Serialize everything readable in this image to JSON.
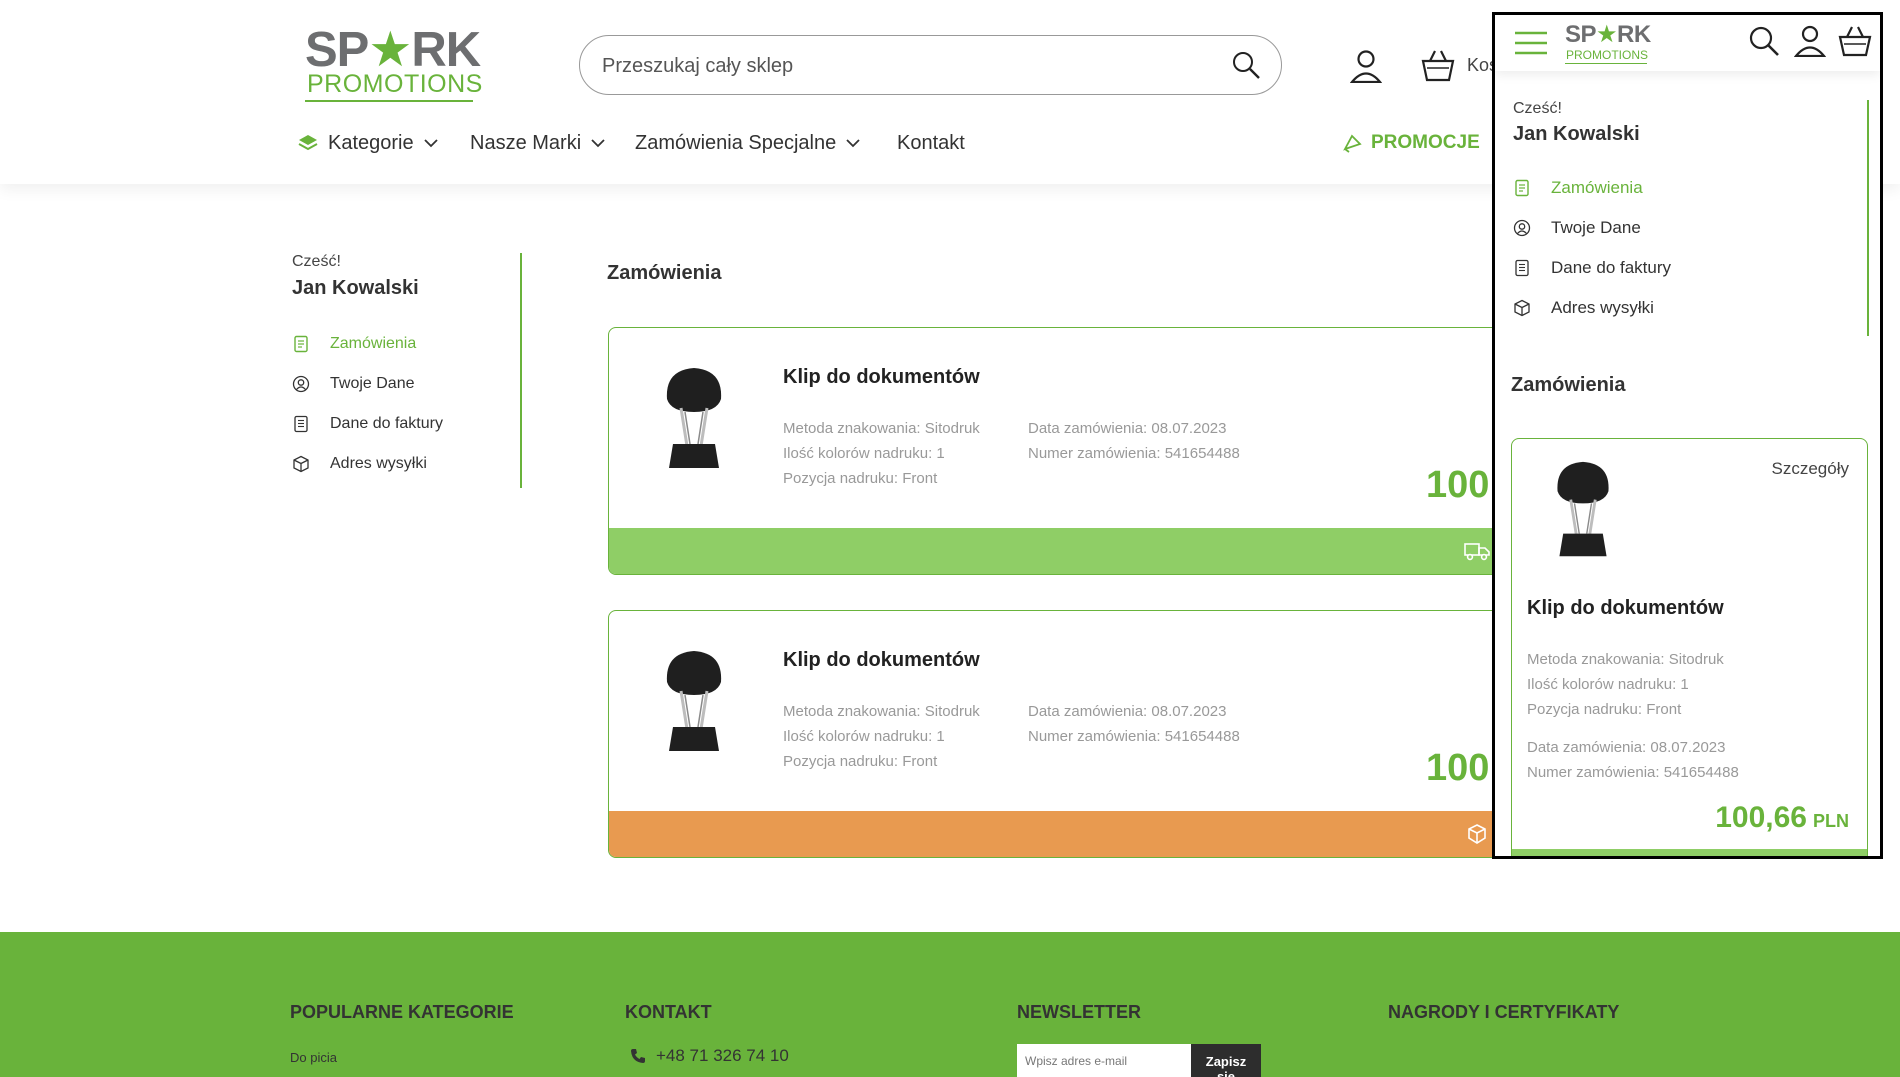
{
  "brand": {
    "line1_a": "SP",
    "line1_star": "★",
    "line1_b": "RK",
    "line2": "PROMOTIONS"
  },
  "header": {
    "search_placeholder": "Przeszukaj cały sklep",
    "cart_label": "Kos"
  },
  "nav": {
    "kategorie": "Kategorie",
    "marki": "Nasze Marki",
    "zamowienia_specjalne": "Zamówienia Specjalne",
    "kontakt": "Kontakt",
    "promocje": "PROMOCJE"
  },
  "account": {
    "greeting": "Cześć!",
    "name": "Jan Kowalski",
    "menu": [
      {
        "label": "Zamówienia",
        "icon": "orders-icon",
        "active": true
      },
      {
        "label": "Twoje Dane",
        "icon": "user-circle-icon",
        "active": false
      },
      {
        "label": "Dane do faktury",
        "icon": "invoice-icon",
        "active": false
      },
      {
        "label": "Adres wysyłki",
        "icon": "package-icon",
        "active": false
      }
    ]
  },
  "main": {
    "title": "Zamówienia",
    "orders": [
      {
        "product": "Klip do dokumentów",
        "method": "Metoda znakowania: Sitodruk",
        "colors": "Ilość kolorów nadruku: 1",
        "position": "Pozycja nadruku: Front",
        "date": "Data zamówienia: 08.07.2023",
        "number": "Numer zamówienia: 541654488",
        "price": "100,",
        "status_color": "#8fce66",
        "status_icon": "truck-icon"
      },
      {
        "product": "Klip do dokumentów",
        "method": "Metoda znakowania: Sitodruk",
        "colors": "Ilość kolorów nadruku: 1",
        "position": "Pozycja nadruku: Front",
        "date": "Data zamówienia: 08.07.2023",
        "number": "Numer zamówienia: 541654488",
        "price": "100,",
        "status_color": "#e89a50",
        "status_icon": "package-icon"
      }
    ]
  },
  "footer": {
    "popular": "POPULARNE KATEGORIE",
    "popular_item": "Do picia",
    "kontakt": "KONTAKT",
    "phone": "+48 71 326 74 10",
    "newsletter": "NEWSLETTER",
    "newsletter_placeholder": "Wpisz adres e-mail",
    "newsletter_button": "Zapisz się",
    "awards": "NAGRODY I CERTYFIKATY"
  },
  "mobile": {
    "greeting": "Cześć!",
    "name": "Jan Kowalski",
    "menu": [
      {
        "label": "Zamówienia",
        "active": true
      },
      {
        "label": "Twoje Dane",
        "active": false
      },
      {
        "label": "Dane do faktury",
        "active": false
      },
      {
        "label": "Adres wysyłki",
        "active": false
      }
    ],
    "title": "Zamówienia",
    "order": {
      "details": "Szczegóły",
      "product": "Klip do dokumentów",
      "method": "Metoda znakowania: Sitodruk",
      "colors": "Ilość kolorów nadruku: 1",
      "position": "Pozycja nadruku: Front",
      "date": "Data zamówienia: 08.07.2023",
      "number": "Numer zamówienia: 541654488",
      "price": "100,66",
      "currency": "PLN"
    }
  },
  "colors": {
    "brand_green": "#69b33b",
    "status_green": "#8fce66",
    "status_orange": "#e89a50"
  }
}
